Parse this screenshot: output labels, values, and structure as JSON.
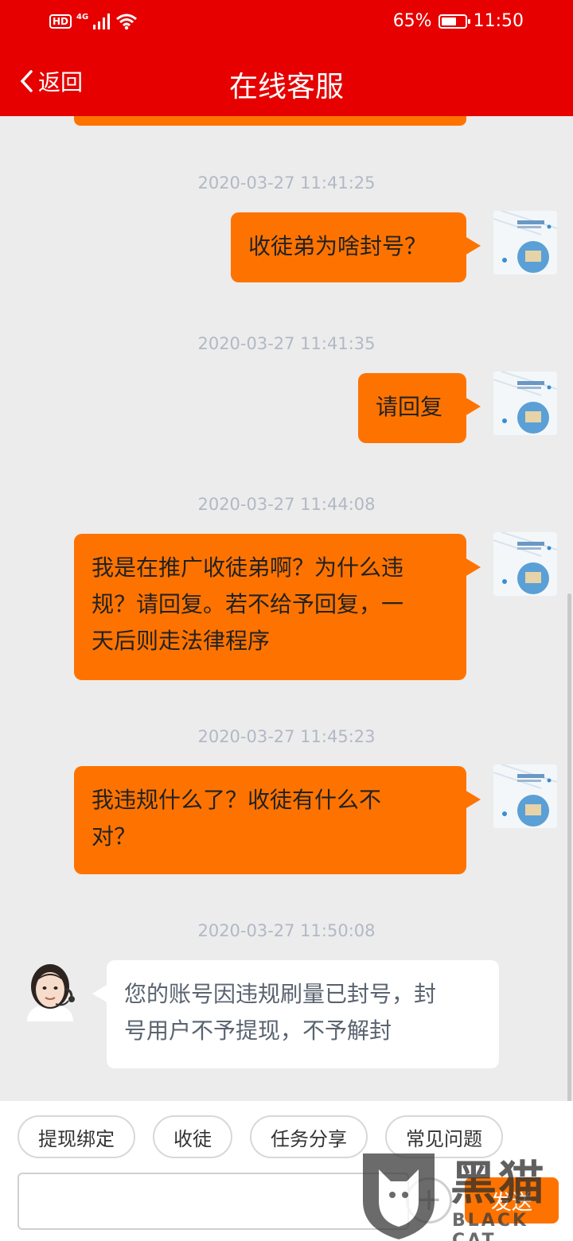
{
  "status_bar": {
    "hd": "HD",
    "network": "4G",
    "battery_text": "65%",
    "battery_level": 0.65,
    "time": "11:50"
  },
  "nav": {
    "back_label": "返回",
    "title": "在线客服"
  },
  "messages": [
    {
      "timestamp": "2020-03-27 11:41:25",
      "lines": [
        "收徒弟为啥封号？"
      ],
      "sender": "user"
    },
    {
      "timestamp": "2020-03-27 11:41:35",
      "lines": [
        "请回复"
      ],
      "sender": "user"
    },
    {
      "timestamp": "2020-03-27 11:44:08",
      "lines": [
        "我是在推广收徒弟啊？为什么违",
        "规？请回复。若不给予回复，一",
        "天后则走法律程序"
      ],
      "sender": "user"
    },
    {
      "timestamp": "2020-03-27 11:45:23",
      "lines": [
        "我违规什么了？收徒有什么不",
        "对？"
      ],
      "sender": "user"
    },
    {
      "timestamp": "2020-03-27 11:50:08",
      "lines": [
        "您的账号因违规刷量已封号，封",
        "号用户不予提现，不予解封"
      ],
      "sender": "agent"
    }
  ],
  "quick_replies": [
    "提现绑定",
    "收徒",
    "任务分享",
    "常见问题"
  ],
  "composer": {
    "value": "",
    "plus_label": "+",
    "send_label": "发送"
  },
  "watermark": {
    "cn": "黑猫",
    "en": "BLACK CAT"
  },
  "colors": {
    "header_red": "#e60000",
    "bubble_orange": "#fe7300",
    "background": "#ececec",
    "timestamp_gray": "#b2b8c5"
  }
}
